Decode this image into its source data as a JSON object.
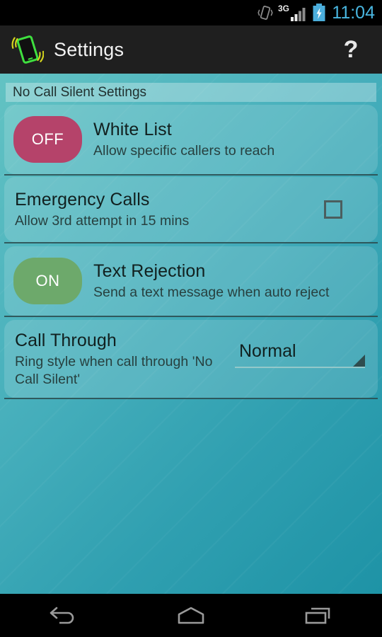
{
  "status_bar": {
    "clock": "11:04",
    "clock_color": "#49B6E0",
    "network_label": "3G",
    "icons": [
      "vibrate-icon",
      "signal-3g-icon",
      "battery-charging-icon"
    ]
  },
  "action_bar": {
    "app_icon": "vibrating-phone-icon",
    "title": "Settings",
    "help_label": "?"
  },
  "theme": {
    "background_top_left": "#63C3C3",
    "background_bottom_right": "#1E93A6",
    "toggle_off_color": "#B5436A",
    "toggle_on_color": "#6DA96B",
    "divider_color": "#2B4A4C",
    "title_color": "#11201F",
    "summary_color": "#27403F"
  },
  "section": {
    "header": "No Call Silent Settings"
  },
  "preferences": [
    {
      "key": "white-list",
      "title": "White List",
      "summary": "Allow specific callers to reach",
      "control": "toggle",
      "toggle_label": "OFF",
      "toggle_state": "off"
    },
    {
      "key": "emergency-calls",
      "title": "Emergency Calls",
      "summary": "Allow 3rd attempt in 15 mins",
      "control": "checkbox",
      "checked": false
    },
    {
      "key": "text-rejection",
      "title": "Text Rejection",
      "summary": "Send a text message when auto reject",
      "control": "toggle",
      "toggle_label": "ON",
      "toggle_state": "on"
    },
    {
      "key": "call-through",
      "title": "Call Through",
      "summary_line1": "Ring style when call through 'No",
      "summary_line2": "Call Silent'",
      "control": "spinner",
      "spinner_value": "Normal"
    }
  ],
  "nav_bar": {
    "buttons": [
      "back-icon",
      "home-icon",
      "recents-icon"
    ]
  }
}
